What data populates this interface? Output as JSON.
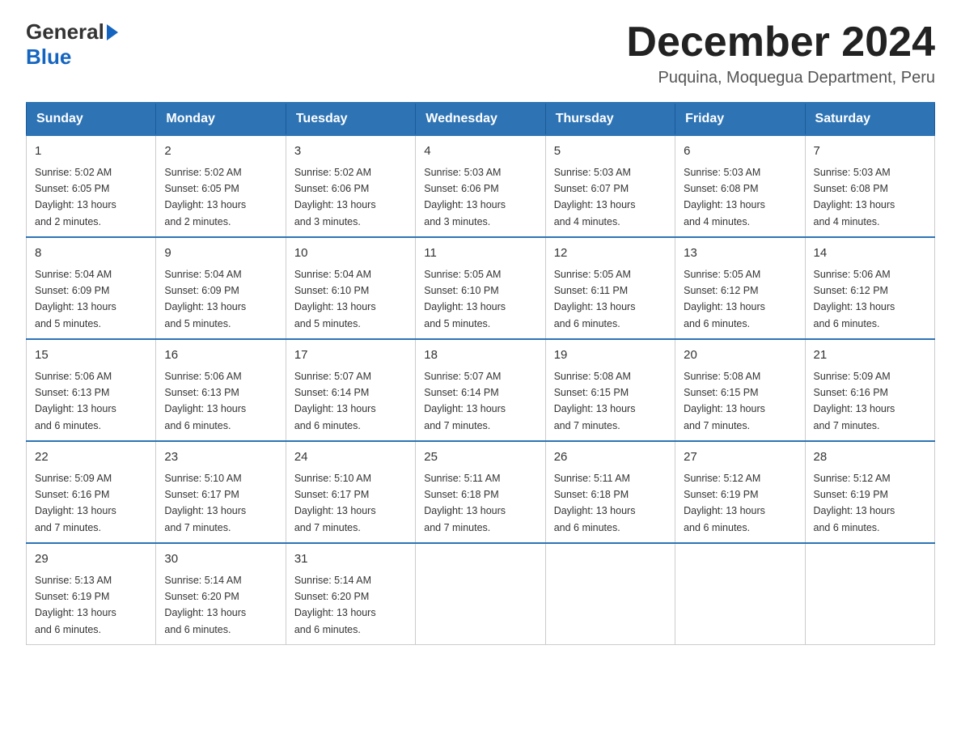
{
  "header": {
    "logo_general": "General",
    "logo_blue": "Blue",
    "month_title": "December 2024",
    "location": "Puquina, Moquegua Department, Peru"
  },
  "weekdays": [
    "Sunday",
    "Monday",
    "Tuesday",
    "Wednesday",
    "Thursday",
    "Friday",
    "Saturday"
  ],
  "weeks": [
    [
      {
        "day": "1",
        "sunrise": "5:02 AM",
        "sunset": "6:05 PM",
        "daylight": "13 hours and 2 minutes."
      },
      {
        "day": "2",
        "sunrise": "5:02 AM",
        "sunset": "6:05 PM",
        "daylight": "13 hours and 2 minutes."
      },
      {
        "day": "3",
        "sunrise": "5:02 AM",
        "sunset": "6:06 PM",
        "daylight": "13 hours and 3 minutes."
      },
      {
        "day": "4",
        "sunrise": "5:03 AM",
        "sunset": "6:06 PM",
        "daylight": "13 hours and 3 minutes."
      },
      {
        "day": "5",
        "sunrise": "5:03 AM",
        "sunset": "6:07 PM",
        "daylight": "13 hours and 4 minutes."
      },
      {
        "day": "6",
        "sunrise": "5:03 AM",
        "sunset": "6:08 PM",
        "daylight": "13 hours and 4 minutes."
      },
      {
        "day": "7",
        "sunrise": "5:03 AM",
        "sunset": "6:08 PM",
        "daylight": "13 hours and 4 minutes."
      }
    ],
    [
      {
        "day": "8",
        "sunrise": "5:04 AM",
        "sunset": "6:09 PM",
        "daylight": "13 hours and 5 minutes."
      },
      {
        "day": "9",
        "sunrise": "5:04 AM",
        "sunset": "6:09 PM",
        "daylight": "13 hours and 5 minutes."
      },
      {
        "day": "10",
        "sunrise": "5:04 AM",
        "sunset": "6:10 PM",
        "daylight": "13 hours and 5 minutes."
      },
      {
        "day": "11",
        "sunrise": "5:05 AM",
        "sunset": "6:10 PM",
        "daylight": "13 hours and 5 minutes."
      },
      {
        "day": "12",
        "sunrise": "5:05 AM",
        "sunset": "6:11 PM",
        "daylight": "13 hours and 6 minutes."
      },
      {
        "day": "13",
        "sunrise": "5:05 AM",
        "sunset": "6:12 PM",
        "daylight": "13 hours and 6 minutes."
      },
      {
        "day": "14",
        "sunrise": "5:06 AM",
        "sunset": "6:12 PM",
        "daylight": "13 hours and 6 minutes."
      }
    ],
    [
      {
        "day": "15",
        "sunrise": "5:06 AM",
        "sunset": "6:13 PM",
        "daylight": "13 hours and 6 minutes."
      },
      {
        "day": "16",
        "sunrise": "5:06 AM",
        "sunset": "6:13 PM",
        "daylight": "13 hours and 6 minutes."
      },
      {
        "day": "17",
        "sunrise": "5:07 AM",
        "sunset": "6:14 PM",
        "daylight": "13 hours and 6 minutes."
      },
      {
        "day": "18",
        "sunrise": "5:07 AM",
        "sunset": "6:14 PM",
        "daylight": "13 hours and 7 minutes."
      },
      {
        "day": "19",
        "sunrise": "5:08 AM",
        "sunset": "6:15 PM",
        "daylight": "13 hours and 7 minutes."
      },
      {
        "day": "20",
        "sunrise": "5:08 AM",
        "sunset": "6:15 PM",
        "daylight": "13 hours and 7 minutes."
      },
      {
        "day": "21",
        "sunrise": "5:09 AM",
        "sunset": "6:16 PM",
        "daylight": "13 hours and 7 minutes."
      }
    ],
    [
      {
        "day": "22",
        "sunrise": "5:09 AM",
        "sunset": "6:16 PM",
        "daylight": "13 hours and 7 minutes."
      },
      {
        "day": "23",
        "sunrise": "5:10 AM",
        "sunset": "6:17 PM",
        "daylight": "13 hours and 7 minutes."
      },
      {
        "day": "24",
        "sunrise": "5:10 AM",
        "sunset": "6:17 PM",
        "daylight": "13 hours and 7 minutes."
      },
      {
        "day": "25",
        "sunrise": "5:11 AM",
        "sunset": "6:18 PM",
        "daylight": "13 hours and 7 minutes."
      },
      {
        "day": "26",
        "sunrise": "5:11 AM",
        "sunset": "6:18 PM",
        "daylight": "13 hours and 6 minutes."
      },
      {
        "day": "27",
        "sunrise": "5:12 AM",
        "sunset": "6:19 PM",
        "daylight": "13 hours and 6 minutes."
      },
      {
        "day": "28",
        "sunrise": "5:12 AM",
        "sunset": "6:19 PM",
        "daylight": "13 hours and 6 minutes."
      }
    ],
    [
      {
        "day": "29",
        "sunrise": "5:13 AM",
        "sunset": "6:19 PM",
        "daylight": "13 hours and 6 minutes."
      },
      {
        "day": "30",
        "sunrise": "5:14 AM",
        "sunset": "6:20 PM",
        "daylight": "13 hours and 6 minutes."
      },
      {
        "day": "31",
        "sunrise": "5:14 AM",
        "sunset": "6:20 PM",
        "daylight": "13 hours and 6 minutes."
      },
      null,
      null,
      null,
      null
    ]
  ],
  "labels": {
    "sunrise": "Sunrise:",
    "sunset": "Sunset:",
    "daylight": "Daylight:"
  }
}
